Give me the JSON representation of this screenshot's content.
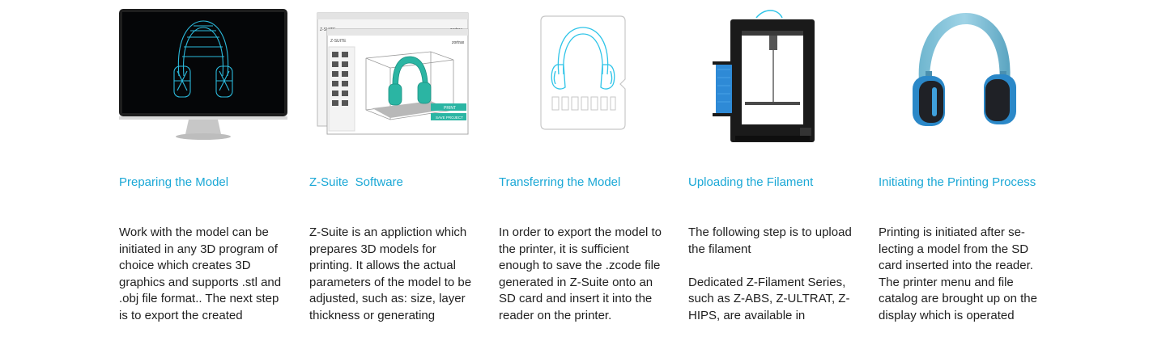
{
  "steps": [
    {
      "title": "Preparing the Model",
      "paragraphs": [
        "Work with the model can be initiated in any 3D program of choice which creates 3D graphics and supports .stl and .obj file format.. The next step is to export the created"
      ],
      "image": "monitor-wireframe-headphones-illustration"
    },
    {
      "title": "Z-Suite  Software",
      "paragraphs": [
        "Z-Suite is an appliction which prepares 3D models for printing. It allows the actual parameters of the model to be adjusted, such as: size, layer thickness or generating"
      ],
      "image": "zsuite-software-screenshot",
      "window_title": "Z-SUITE",
      "brand": "zortrax",
      "print_button": "PRINT",
      "save_button": "SAVE PROJECT"
    },
    {
      "title": "Transferring the Model",
      "paragraphs": [
        "In order to export the model to the printer, it is sufficient enough to save the .zcode file generated in Z-Suite onto an SD card and insert it into the reader on the printer."
      ],
      "image": "sd-card-headphones-illustration"
    },
    {
      "title": "Uploading the Filament",
      "paragraphs": [
        "The following step is to upload the filament",
        "Dedicated Z-Filament Series, such as Z-ABS, Z-ULTRAT, Z-HIPS, are available in"
      ],
      "image": "3d-printer-photo"
    },
    {
      "title": "Initiating the Printing Process",
      "paragraphs": [
        "Printing is initiated after se-lecting a model from the SD card inserted into the reader. The printer menu and file catalog are brought up on the display which is operated"
      ],
      "image": "printed-headphones-photo"
    }
  ],
  "colors": {
    "accent": "#1ba8d6",
    "text": "#1f1f1f",
    "teal": "#2bb5a3",
    "cyan": "#2ec4e8"
  }
}
